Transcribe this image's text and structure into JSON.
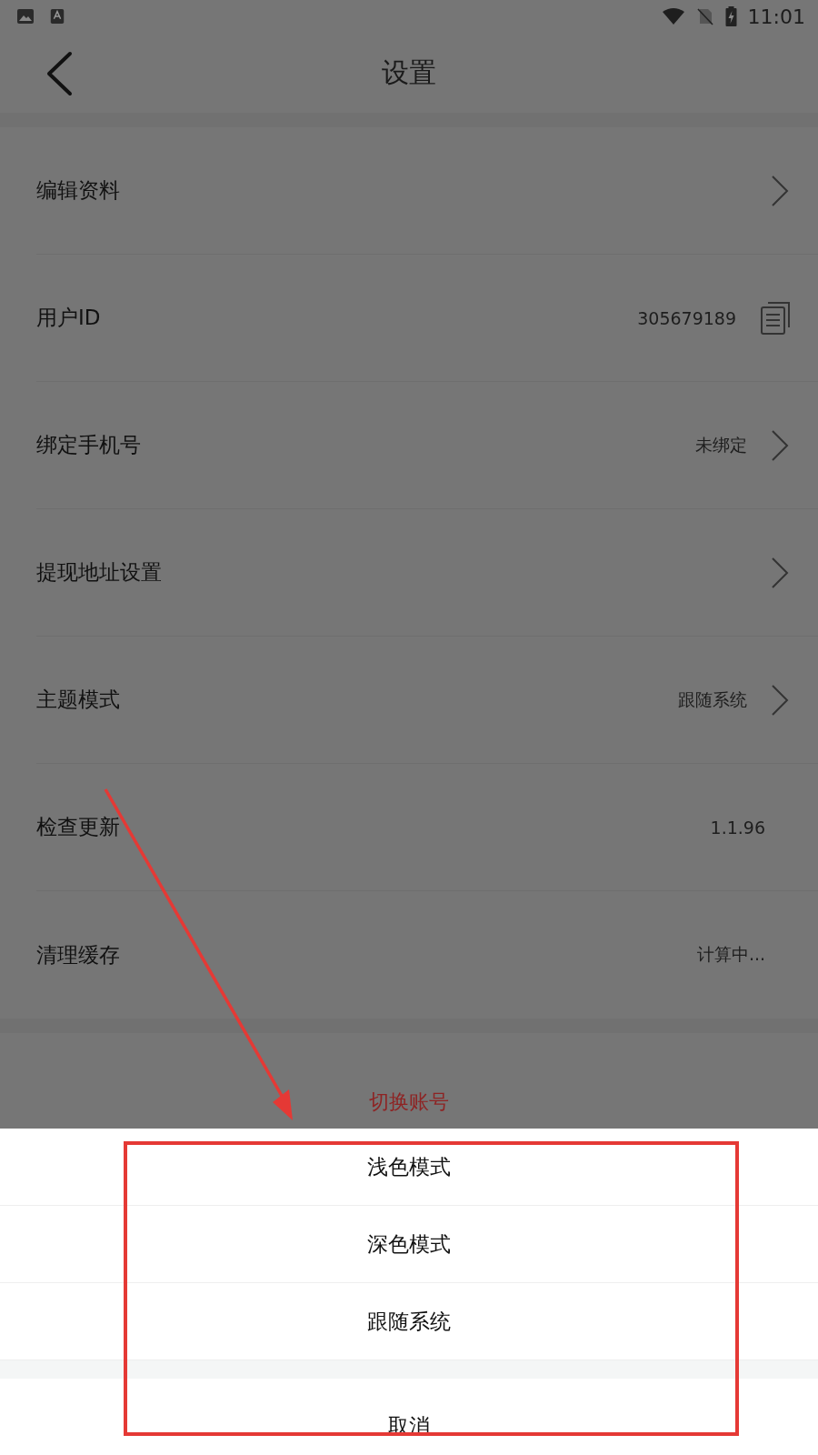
{
  "status_bar": {
    "time": "11:01"
  },
  "header": {
    "title": "设置"
  },
  "settings": [
    {
      "label": "编辑资料",
      "kind": "link"
    },
    {
      "label": "用户ID",
      "kind": "copy",
      "value": "305679189"
    },
    {
      "label": "绑定手机号",
      "kind": "link",
      "value": "未绑定"
    },
    {
      "label": "提现地址设置",
      "kind": "link"
    },
    {
      "label": "主题模式",
      "kind": "link",
      "value": "跟随系统"
    },
    {
      "label": "检查更新",
      "kind": "plain",
      "value": "1.1.96"
    },
    {
      "label": "清理缓存",
      "kind": "plain",
      "value": "计算中..."
    }
  ],
  "switch_account": "切换账号",
  "theme_sheet": {
    "options": [
      "浅色模式",
      "深色模式",
      "跟随系统"
    ],
    "cancel": "取消"
  }
}
